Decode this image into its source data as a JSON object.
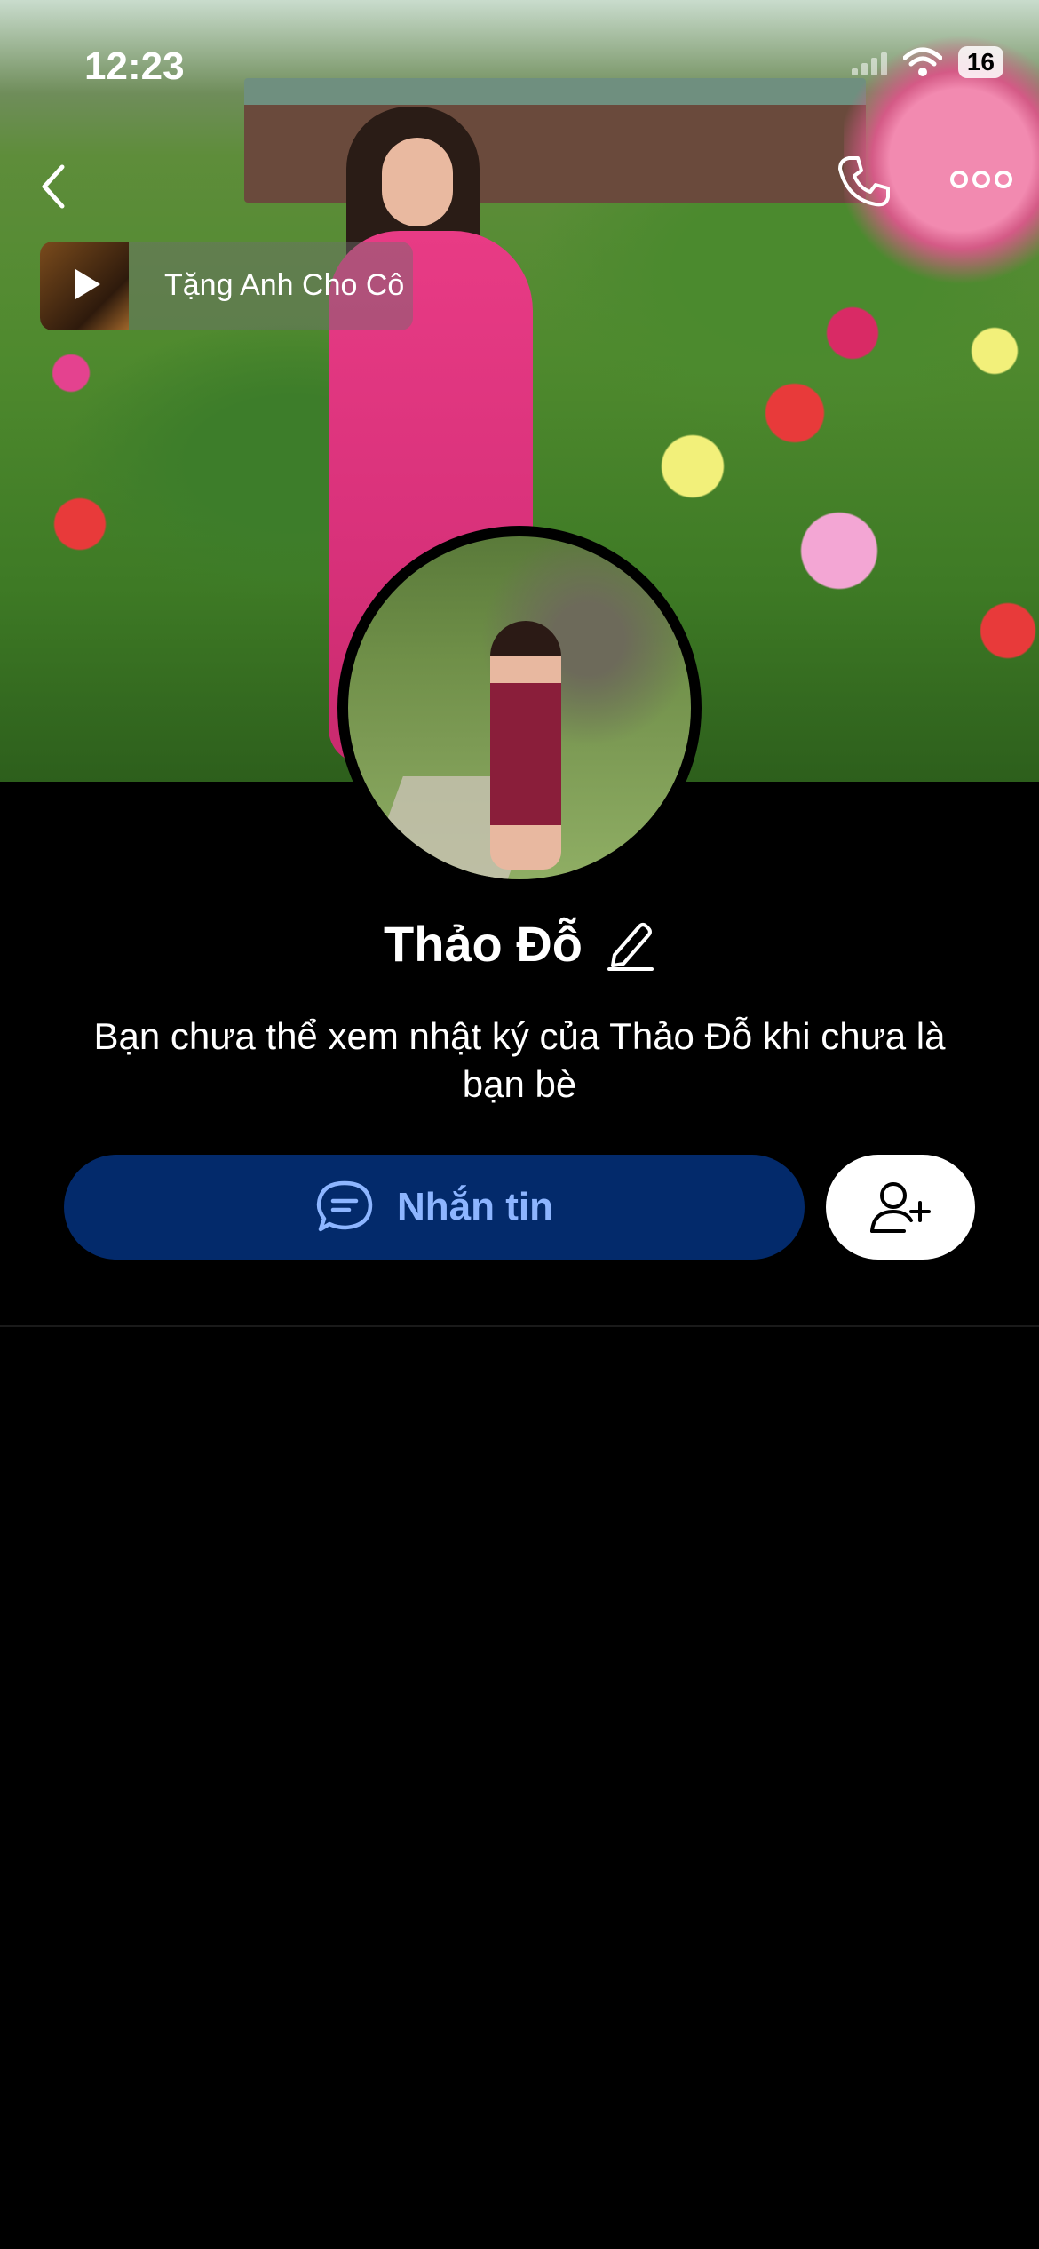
{
  "status_bar": {
    "time": "12:23",
    "battery": "16"
  },
  "music": {
    "title": "Tặng Anh Cho Cô"
  },
  "profile": {
    "name": "Thảo Đỗ",
    "privacy_message": "Bạn chưa thể xem nhật ký của Thảo Đỗ khi chưa là bạn bè"
  },
  "actions": {
    "message_label": "Nhắn tin"
  },
  "colors": {
    "message_button_bg": "#032a6b",
    "message_label": "#8db5ff",
    "background": "#000000"
  },
  "icons": [
    "back-icon",
    "phone-icon",
    "more-icon",
    "play-icon",
    "edit-icon",
    "chat-icon",
    "add-friend-icon",
    "wifi-icon",
    "signal-icon"
  ]
}
